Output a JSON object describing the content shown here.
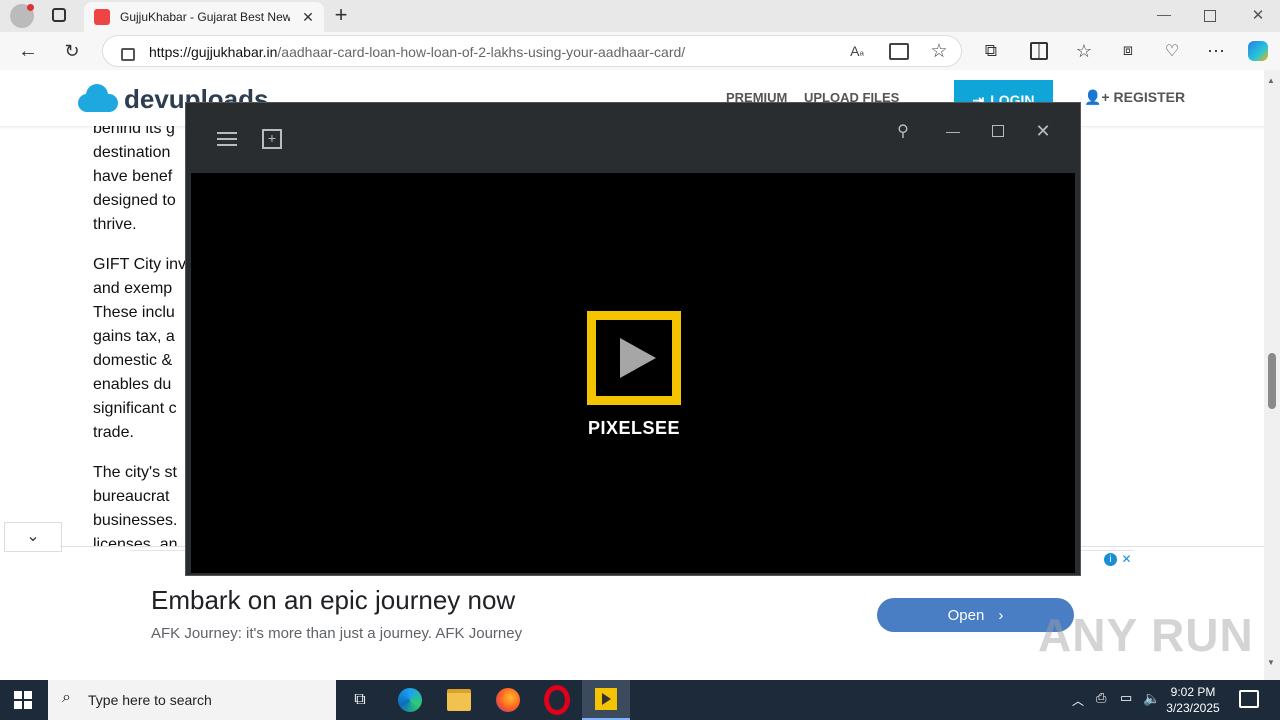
{
  "browser": {
    "tab_title": "GujjuKhabar - Gujarat Best News",
    "url_host": "https://gujjukhabar.in",
    "url_path": "/aadhaar-card-loan-how-loan-of-2-lakhs-using-your-aadhaar-card/"
  },
  "site": {
    "logo": "devuploads",
    "nav": [
      "PREMIUM",
      "UPLOAD FILES"
    ],
    "login": "LOGIN",
    "register": "REGISTER"
  },
  "article": {
    "lines": [
      "behind its g",
      "destination",
      "have benef",
      "designed to",
      "thrive.",
      "GIFT City inv",
      "and exemp",
      "These inclu",
      "gains tax, a",
      "domestic &",
      "enables du",
      "significant c",
      "trade.",
      "The city's st",
      "bureaucrat",
      "businesses.",
      "licenses, an"
    ]
  },
  "ad": {
    "title": "Embark on an epic journey now",
    "subtitle": "AFK Journey: it's more than just a journey. AFK Journey",
    "button": "Open"
  },
  "player": {
    "brand": "PIXELSEE"
  },
  "watermark": "ANY RUN",
  "taskbar": {
    "search_placeholder": "Type here to search",
    "time": "9:02 PM",
    "date": "3/23/2025"
  },
  "colors": {
    "pixelsee_yellow": "#f5c400",
    "login_blue": "#0fa5d8",
    "ad_button": "#4a7ec4",
    "taskbar": "#1c2a3a"
  }
}
